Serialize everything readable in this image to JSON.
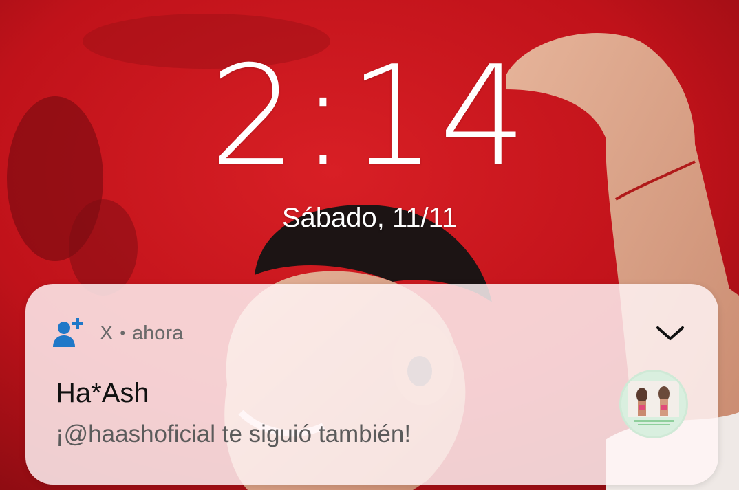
{
  "lockscreen": {
    "time": "2:14",
    "date": "Sábado, 11/11"
  },
  "notification": {
    "app_icon": "person-add-icon",
    "app_name": "X",
    "separator": "•",
    "timestamp": "ahora",
    "expand_icon": "chevron-down-icon",
    "title": "Ha*Ash",
    "body": "¡@haashoficial te siguió también!",
    "avatar_icon": "profile-avatar-image"
  },
  "colors": {
    "wallpaper_red": "#c4131c",
    "app_icon_blue": "#1f78c8",
    "card_background": "#fff4f6"
  }
}
